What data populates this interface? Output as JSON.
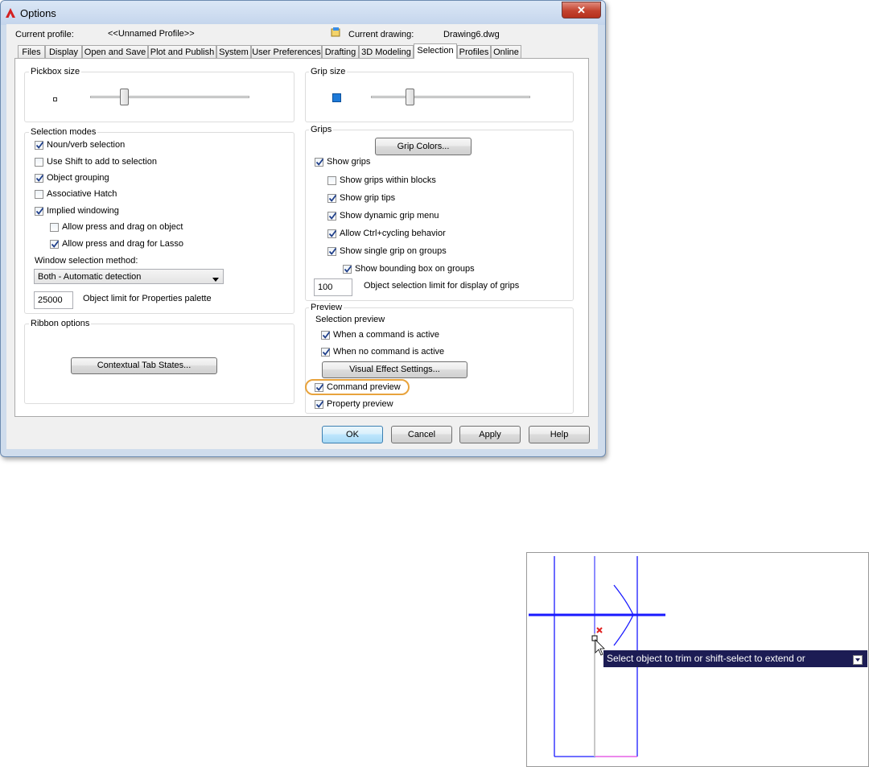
{
  "window": {
    "title": "Options",
    "close_glyph": "✕"
  },
  "header": {
    "current_profile_label": "Current profile:",
    "current_profile_value": "<<Unnamed Profile>>",
    "current_drawing_label": "Current drawing:",
    "current_drawing_value": "Drawing6.dwg"
  },
  "tabs": [
    {
      "label": "Files"
    },
    {
      "label": "Display"
    },
    {
      "label": "Open and Save"
    },
    {
      "label": "Plot and Publish"
    },
    {
      "label": "System"
    },
    {
      "label": "User Preferences"
    },
    {
      "label": "Drafting"
    },
    {
      "label": "3D Modeling"
    },
    {
      "label": "Selection",
      "selected": true
    },
    {
      "label": "Profiles"
    },
    {
      "label": "Online"
    }
  ],
  "pickbox": {
    "title": "Pickbox size",
    "level": 0.2
  },
  "grip_size": {
    "title": "Grip size",
    "level": 0.23,
    "swatch_color": "#1e7ad8"
  },
  "selection_modes": {
    "title": "Selection modes",
    "noun_verb": {
      "label": "Noun/verb selection",
      "checked": true
    },
    "use_shift": {
      "label": "Use Shift to add to selection",
      "checked": false
    },
    "object_grouping": {
      "label": "Object grouping",
      "checked": true
    },
    "assoc_hatch": {
      "label": "Associative Hatch",
      "checked": false
    },
    "implied_windowing": {
      "label": "Implied windowing",
      "checked": true
    },
    "press_drag_object": {
      "label": "Allow press and drag on object",
      "checked": false
    },
    "press_drag_lasso": {
      "label": "Allow press and drag for Lasso",
      "checked": true
    },
    "window_method_label": "Window selection method:",
    "window_method_value": "Both - Automatic detection",
    "object_limit_value": "25000",
    "object_limit_label": "Object limit for Properties palette"
  },
  "ribbon": {
    "title": "Ribbon options",
    "contextual_button": "Contextual Tab States..."
  },
  "grips": {
    "title": "Grips",
    "grip_colors_button": "Grip Colors...",
    "show_grips": {
      "label": "Show grips",
      "checked": true
    },
    "within_blocks": {
      "label": "Show grips within blocks",
      "checked": false
    },
    "grip_tips": {
      "label": "Show grip tips",
      "checked": true
    },
    "dynamic_menu": {
      "label": "Show dynamic grip menu",
      "checked": true
    },
    "ctrl_cycling": {
      "label": "Allow Ctrl+cycling behavior",
      "checked": true
    },
    "single_grip": {
      "label": "Show single grip on groups",
      "checked": true
    },
    "bounding_box": {
      "label": "Show bounding box on groups",
      "checked": true
    },
    "limit_value": "100",
    "limit_label": "Object selection limit for display of grips"
  },
  "preview": {
    "title": "Preview",
    "selection_preview_label": "Selection preview",
    "cmd_active": {
      "label": "When a command is active",
      "checked": true
    },
    "no_cmd_active": {
      "label": "When no command is active",
      "checked": true
    },
    "visual_effect_button": "Visual Effect Settings...",
    "command_preview": {
      "label": "Command preview",
      "checked": true
    },
    "property_preview": {
      "label": "Property preview",
      "checked": true
    },
    "highlight_color": "#e8a33c"
  },
  "buttons": {
    "ok": "OK",
    "cancel": "Cancel",
    "apply": "Apply",
    "help": "Help"
  },
  "cad": {
    "tooltip_text": "Select object to trim or shift-select to extend or",
    "tooltip_icon": "dropdown-icon",
    "line_color": "#1a1aff",
    "magenta_color": "#e040e0"
  }
}
